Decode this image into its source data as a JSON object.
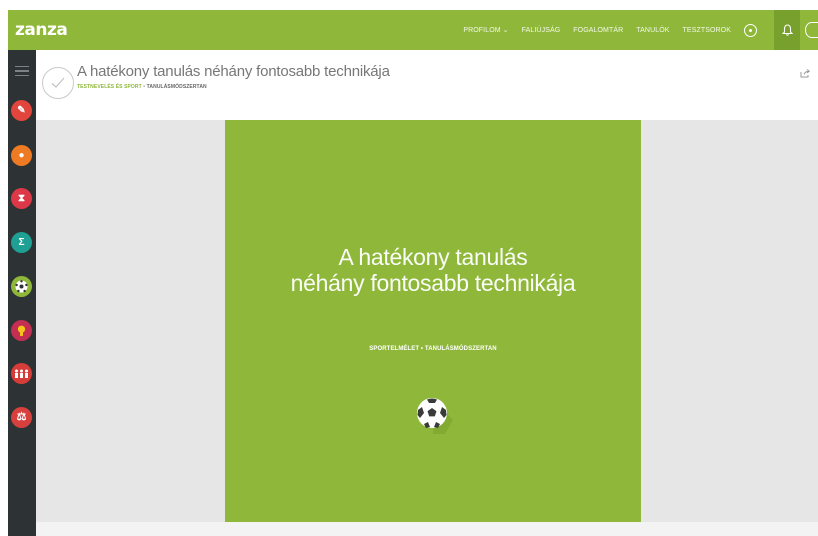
{
  "app": {
    "logo": "zanza",
    "accent": "#8fb83a"
  },
  "nav": {
    "items": [
      {
        "label": "PROFILOM",
        "dropdown": true
      },
      {
        "label": "FALIÚJSÁG"
      },
      {
        "label": "FOGALOMTÁR"
      },
      {
        "label": "TANULÓK"
      },
      {
        "label": "TESZTSOROK"
      }
    ],
    "icons": [
      "settings-icon",
      "bell-icon",
      "search-icon"
    ]
  },
  "sidebar": {
    "categories": [
      {
        "name": "pen-icon",
        "color": "#e2453b",
        "glyph": "✎"
      },
      {
        "name": "speech-bubble-icon",
        "color": "#ee7a23",
        "glyph": "●"
      },
      {
        "name": "hourglass-icon",
        "color": "#dc3848",
        "glyph": "⧗"
      },
      {
        "name": "sigma-icon",
        "color": "#1ea095",
        "glyph": "Σ"
      },
      {
        "name": "soccer-ball-icon",
        "color": "#8fb83a",
        "glyph": "✿"
      },
      {
        "name": "lightbulb-icon",
        "color": "#c42e52",
        "glyph": "♦"
      },
      {
        "name": "people-icon",
        "color": "#d63c38",
        "glyph": "☗"
      },
      {
        "name": "scales-icon",
        "color": "#d8403d",
        "glyph": "⚖"
      }
    ]
  },
  "header": {
    "title": "A hatékony tanulás néhány fontosabb technikája",
    "breadcrumb": {
      "category": "TESTNEVELÉS ÉS SPORT",
      "separator": " • ",
      "topic": "TANULÁSMÓDSZERTAN"
    }
  },
  "cover": {
    "title_line1": "A hatékony tanulás",
    "title_line2": "néhány fontosabb technikája",
    "subtitle": "SPORTELMÉLET • TANULÁSMÓDSZERTAN"
  }
}
